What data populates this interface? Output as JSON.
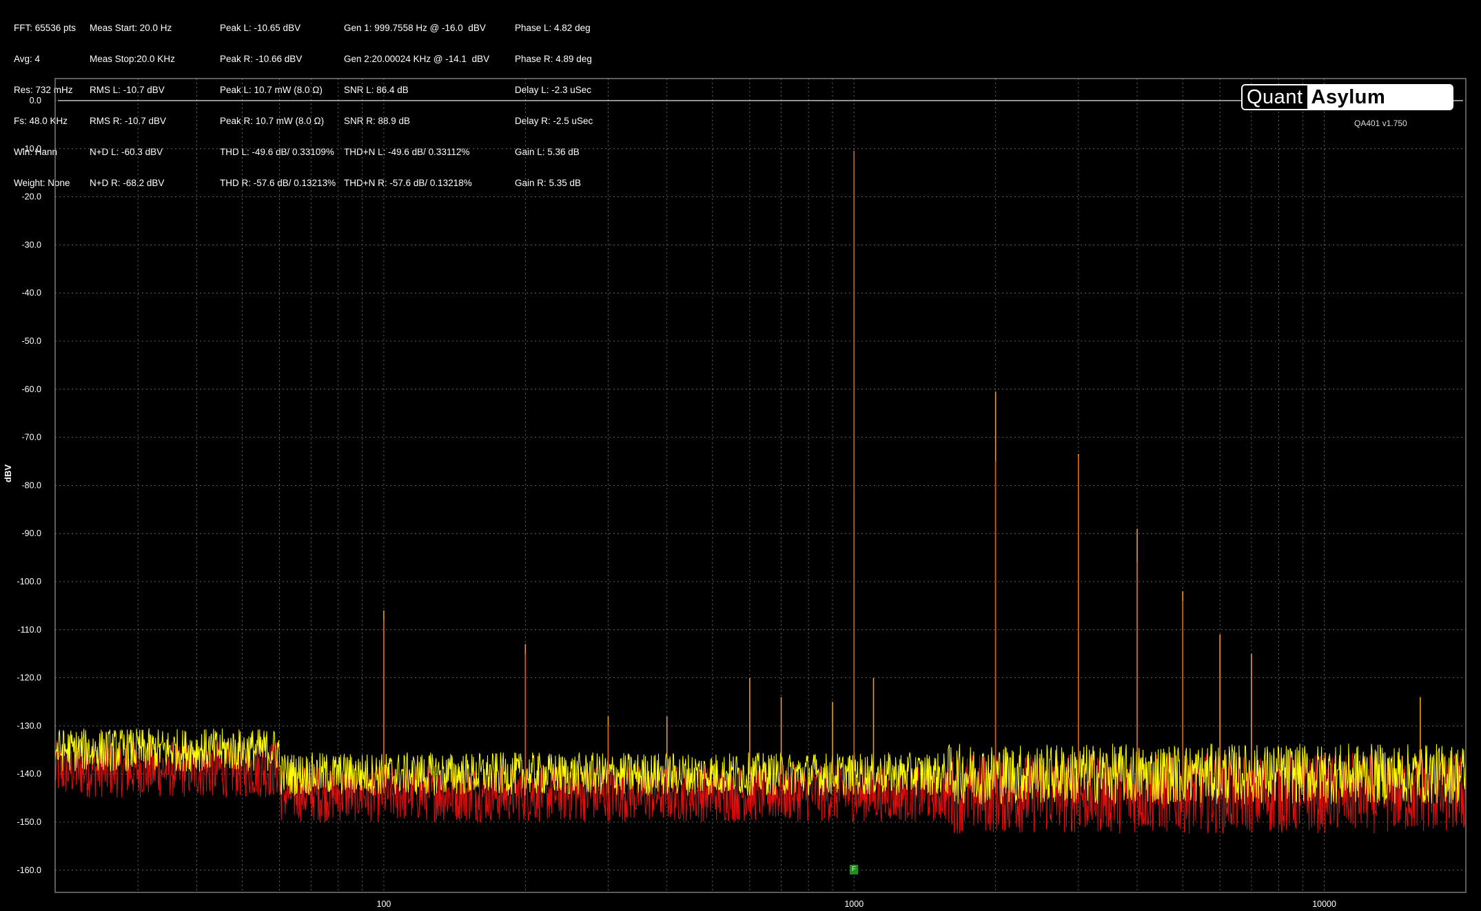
{
  "stats": {
    "col1": [
      "FFT: 65536 pts",
      "Avg: 4",
      "Res: 732 mHz",
      "Fs: 48.0 KHz",
      "Win: Hann",
      "Weight: None"
    ],
    "col2": [
      "Meas Start: 20.0 Hz",
      "Meas Stop:20.0 KHz",
      "RMS L: -10.7 dBV",
      "RMS R: -10.7 dBV",
      "N+D L: -60.3 dBV",
      "N+D R: -68.2 dBV"
    ],
    "col3": [
      "Peak L: -10.65 dBV",
      "Peak R: -10.66 dBV",
      "Peak L: 10.7 mW (8.0 Ω)",
      "Peak R: 10.7 mW (8.0 Ω)",
      "THD L: -49.6 dB/ 0.33109%",
      "THD R: -57.6 dB/ 0.13213%"
    ],
    "col4": [
      "Gen 1: 999.7558 Hz @ -16.0  dBV",
      "Gen 2:20.00024 KHz @ -14.1  dBV",
      "SNR L: 86.4 dB",
      "SNR R: 88.9 dB",
      "THD+N L: -49.6 dB/ 0.33112%",
      "THD+N R: -57.6 dB/ 0.13218%"
    ],
    "col5": [
      "Phase L: 4.82 deg",
      "Phase R: 4.89 deg",
      "Delay L: -2.3 uSec",
      "Delay R: -2.5 uSec",
      "Gain L: 5.36 dB",
      "Gain R: 5.35 dB"
    ]
  },
  "logo": {
    "left": "Quant",
    "right": "Asylum"
  },
  "version": "QA401 v1.750",
  "marker_label": "F",
  "colors": {
    "left_channel": "#ffff00",
    "right_channel": "#e01010",
    "grid": "#7a7a7a",
    "background": "#000000"
  },
  "chart_data": {
    "type": "line",
    "xscale": "log",
    "xlim": [
      20,
      20000
    ],
    "ylim": [
      -165,
      5
    ],
    "ylabel": "dBV",
    "xlabel": "",
    "x_ticks": [
      100,
      1000,
      10000
    ],
    "x_tick_labels": [
      "100",
      "1000",
      "10000"
    ],
    "y_ticks": [
      0,
      -10,
      -20,
      -30,
      -40,
      -50,
      -60,
      -70,
      -80,
      -90,
      -100,
      -110,
      -120,
      -130,
      -140,
      -150,
      -160
    ],
    "y_tick_labels": [
      "0.0",
      "-10.0",
      "-20.0",
      "-30.0",
      "-40.0",
      "-50.0",
      "-60.0",
      "-70.0",
      "-80.0",
      "-90.0",
      "-100.0",
      "-110.0",
      "-120.0",
      "-130.0",
      "-140.0",
      "-150.0",
      "-160.0"
    ],
    "reference_line_dbv": 0,
    "grid": true,
    "series": [
      {
        "name": "L",
        "noise_floor_dbv": -140,
        "peaks": [
          {
            "freq": 100,
            "dbv": -106
          },
          {
            "freq": 200,
            "dbv": -113
          },
          {
            "freq": 300,
            "dbv": -128
          },
          {
            "freq": 400,
            "dbv": -128
          },
          {
            "freq": 600,
            "dbv": -120
          },
          {
            "freq": 700,
            "dbv": -124
          },
          {
            "freq": 900,
            "dbv": -125
          },
          {
            "freq": 1000,
            "dbv": -10.5
          },
          {
            "freq": 1100,
            "dbv": -120
          },
          {
            "freq": 2000,
            "dbv": -60.5
          },
          {
            "freq": 3000,
            "dbv": -73.5
          },
          {
            "freq": 4000,
            "dbv": -89
          },
          {
            "freq": 5000,
            "dbv": -102
          },
          {
            "freq": 6000,
            "dbv": -111
          },
          {
            "freq": 7000,
            "dbv": -115
          },
          {
            "freq": 16000,
            "dbv": -124
          }
        ]
      },
      {
        "name": "R",
        "noise_floor_dbv": -144,
        "peaks": [
          {
            "freq": 100,
            "dbv": -108
          },
          {
            "freq": 200,
            "dbv": -115
          },
          {
            "freq": 300,
            "dbv": -130
          },
          {
            "freq": 1000,
            "dbv": -10.7
          },
          {
            "freq": 2000,
            "dbv": -75
          },
          {
            "freq": 3000,
            "dbv": -74
          },
          {
            "freq": 4000,
            "dbv": -96
          },
          {
            "freq": 5000,
            "dbv": -104
          }
        ]
      }
    ]
  }
}
